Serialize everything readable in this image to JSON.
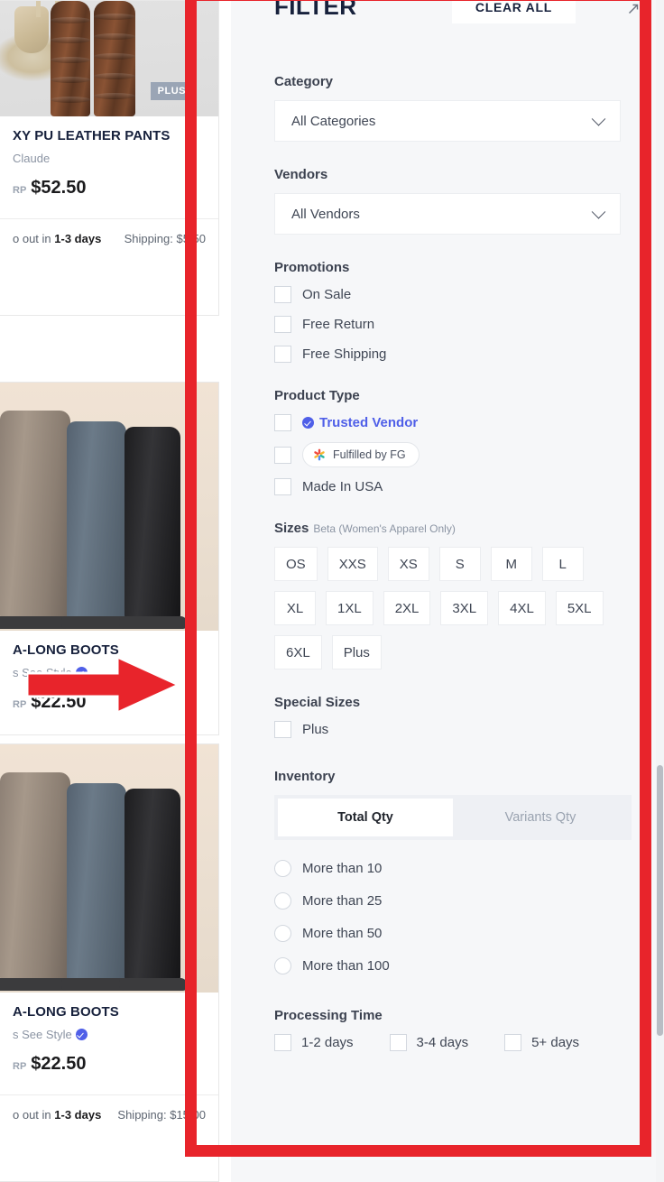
{
  "products": [
    {
      "title": "XY PU LEATHER PANTS",
      "vendor": "Claude",
      "price_label": "RP",
      "price": "$52.50",
      "ships": "out in",
      "ship_days": "1-3 days",
      "shipping": "Shipping: $5.50",
      "badge": "PLUS",
      "image": "leather-pants-photo"
    },
    {
      "title": "A-LONG BOOTS",
      "vendor": "s See Style",
      "price_label": "RP",
      "price": "$22.50",
      "verified_icon": "verified-badge-icon",
      "image": "tall-boots-photo"
    },
    {
      "title": "A-LONG BOOTS",
      "vendor": "s See Style",
      "price_label": "RP",
      "price": "$22.50",
      "verified_icon": "verified-badge-icon",
      "ships": "out in",
      "ship_days": "1-3 days",
      "shipping": "Shipping: $15.00",
      "image": "tall-boots-photo"
    }
  ],
  "filter": {
    "title": "FILTER",
    "clear_all": "CLEAR ALL",
    "expand_icon": "expand-diagonal-icon",
    "category": {
      "label": "Category",
      "value": "All Categories",
      "chevron_icon": "chevron-down-icon"
    },
    "vendors": {
      "label": "Vendors",
      "value": "All Vendors",
      "chevron_icon": "chevron-down-icon"
    },
    "promotions": {
      "label": "Promotions",
      "options": [
        {
          "label": "On Sale",
          "checked": false
        },
        {
          "label": "Free Return",
          "checked": false
        },
        {
          "label": "Free Shipping",
          "checked": false
        }
      ]
    },
    "product_type": {
      "label": "Product Type",
      "trusted_vendor": {
        "label": "Trusted Vendor",
        "icon": "verified-badge-icon",
        "color": "#4f5fe8",
        "checked": false
      },
      "fulfilled_by_fg": {
        "label": "Fulfilled by FG",
        "icon": "fg-flower-icon",
        "checked": false
      },
      "made_in_usa": {
        "label": "Made In USA",
        "checked": false
      }
    },
    "sizes": {
      "label": "Sizes",
      "sub_label": "Beta (Women's Apparel Only)",
      "chips": [
        "OS",
        "XXS",
        "XS",
        "S",
        "M",
        "L",
        "XL",
        "1XL",
        "2XL",
        "3XL",
        "4XL",
        "5XL",
        "6XL",
        "Plus"
      ]
    },
    "special_sizes": {
      "label": "Special Sizes",
      "options": [
        {
          "label": "Plus",
          "checked": false
        }
      ]
    },
    "inventory": {
      "label": "Inventory",
      "tabs": [
        {
          "label": "Total Qty",
          "active": true
        },
        {
          "label": "Variants Qty",
          "active": false
        }
      ],
      "options": [
        {
          "label": "More than 10",
          "selected": false
        },
        {
          "label": "More than 25",
          "selected": false
        },
        {
          "label": "More than 50",
          "selected": false
        },
        {
          "label": "More than 100",
          "selected": false
        }
      ]
    },
    "processing_time": {
      "label": "Processing Time",
      "options": [
        {
          "label": "1-2 days",
          "checked": false
        },
        {
          "label": "3-4 days",
          "checked": false
        },
        {
          "label": "5+ days",
          "checked": false
        }
      ]
    }
  },
  "annotations": {
    "box_color": "#e8242b",
    "arrow_color": "#e8242b",
    "arrow_direction": "right"
  }
}
